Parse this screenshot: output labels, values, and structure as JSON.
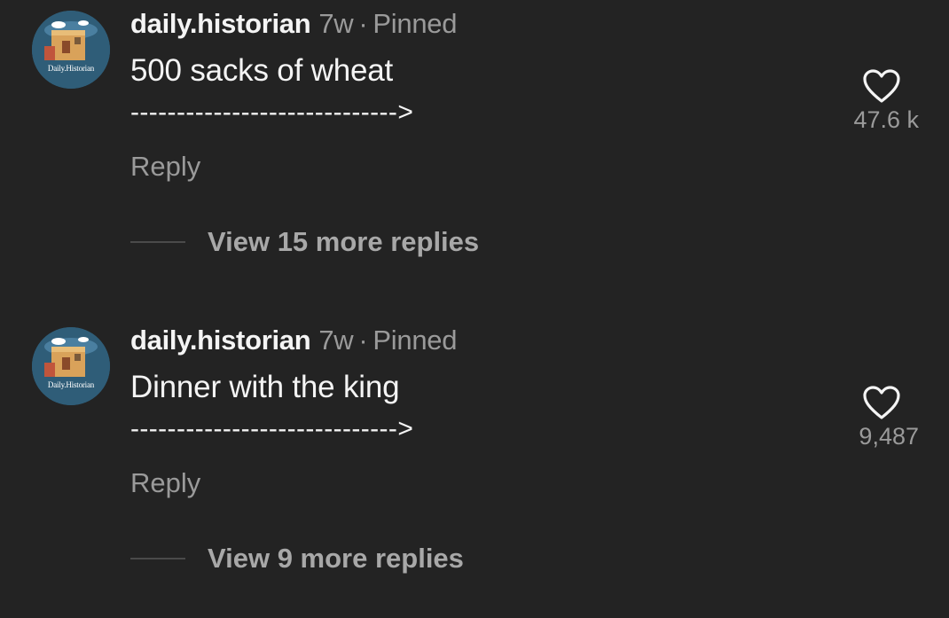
{
  "comments": [
    {
      "avatar_label": "Daily.Historian",
      "username": "daily.historian",
      "time": "7w",
      "separator": "·",
      "pinned": "Pinned",
      "text": "500 sacks of wheat",
      "arrow_text": "----------------------------->",
      "likes": "47.6 k",
      "reply_label": "Reply",
      "view_replies": "View 15 more replies"
    },
    {
      "avatar_label": "Daily.Historian",
      "username": "daily.historian",
      "time": "7w",
      "separator": "·",
      "pinned": "Pinned",
      "text": "Dinner with the king",
      "arrow_text": "----------------------------->",
      "likes": "9,487",
      "reply_label": "Reply",
      "view_replies": "View 9 more replies"
    }
  ],
  "icons": {
    "like": "heart-icon"
  },
  "colors": {
    "background": "#232323",
    "primary_text": "#f4f4f4",
    "secondary_text": "#9a9a9a",
    "avatar_bg": "#2f5d78"
  }
}
